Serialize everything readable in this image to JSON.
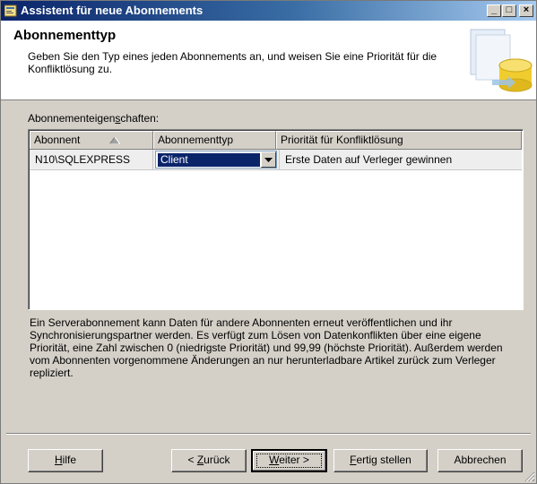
{
  "window": {
    "title": "Assistent für neue Abonnements",
    "controls": {
      "minimize": "_",
      "maximize": "□",
      "close": "×"
    }
  },
  "header": {
    "title": "Abonnementtyp",
    "description": "Geben Sie den Typ eines jeden Abonnements an, und weisen Sie eine Priorität für die Konfliktlösung zu."
  },
  "properties": {
    "label_pre": "Abonnementeigen",
    "label_accel": "s",
    "label_post": "chaften:",
    "columns": [
      "Abonnent",
      "Abonnementtyp",
      "Priorität für Konfliktlösung"
    ],
    "rows": [
      {
        "subscriber": "N10\\SQLEXPRESS",
        "type": "Client",
        "priority": "Erste Daten auf Verleger gewinnen"
      }
    ]
  },
  "info_text": "Ein Serverabonnement kann Daten für andere Abonnenten erneut veröffentlichen und ihr Synchronisierungspartner werden. Es verfügt zum Lösen von Datenkonflikten über eine eigene Priorität, eine Zahl zwischen 0 (niedrigste Priorität) und 99,99 (höchste Priorität). Außerdem werden vom Abonnenten vorgenommene Änderungen an nur herunterladbare Artikel zurück zum Verleger repliziert.",
  "buttons": {
    "help": {
      "accel": "H",
      "rest": "ilfe"
    },
    "back": {
      "pre": "< ",
      "accel": "Z",
      "rest": "urück"
    },
    "next": {
      "accel": "W",
      "rest": "eiter >"
    },
    "finish": {
      "accel": "F",
      "rest": "ertig stellen"
    },
    "cancel": "Abbrechen"
  },
  "colors": {
    "title_bar": "#0a246a",
    "selection": "#0a246a",
    "dialog_bg": "#d4d0c8"
  },
  "icons": [
    "wizard-app-icon",
    "database-header-graphic",
    "sort-ascending-icon",
    "dropdown-arrow-icon",
    "resize-grip-icon"
  ]
}
